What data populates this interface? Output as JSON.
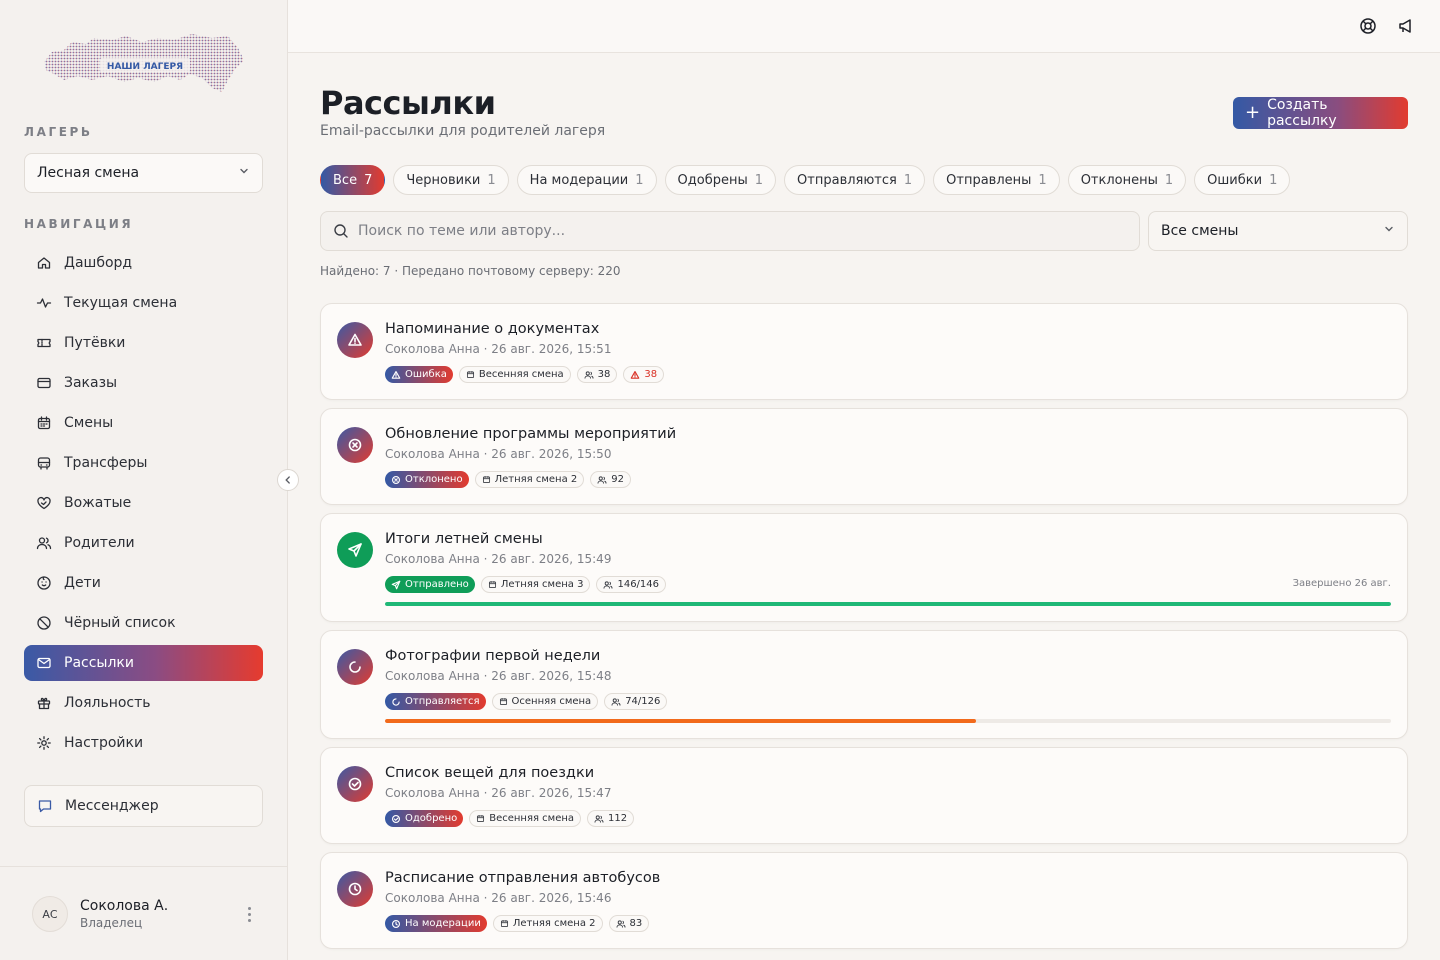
{
  "brand": {
    "logo_text": "НАШИ ЛАГЕРЯ"
  },
  "sidebar": {
    "camp_label": "ЛАГЕРЬ",
    "camp_value": "Лесная смена",
    "nav_label": "НАВИГАЦИЯ",
    "items": [
      {
        "label": "Дашборд",
        "icon": "home-icon"
      },
      {
        "label": "Текущая смена",
        "icon": "activity-icon"
      },
      {
        "label": "Путёвки",
        "icon": "ticket-icon"
      },
      {
        "label": "Заказы",
        "icon": "card-icon"
      },
      {
        "label": "Смены",
        "icon": "calendar-icon"
      },
      {
        "label": "Трансферы",
        "icon": "bus-icon"
      },
      {
        "label": "Вожатые",
        "icon": "heart-handshake-icon"
      },
      {
        "label": "Родители",
        "icon": "users-icon"
      },
      {
        "label": "Дети",
        "icon": "baby-icon"
      },
      {
        "label": "Чёрный список",
        "icon": "ban-icon"
      },
      {
        "label": "Рассылки",
        "icon": "mail-icon",
        "active": true
      },
      {
        "label": "Лояльность",
        "icon": "gift-icon"
      },
      {
        "label": "Настройки",
        "icon": "settings-icon"
      }
    ],
    "messenger": "Мессенджер",
    "user": {
      "initials": "АС",
      "name": "Соколова А.",
      "role": "Владелец"
    }
  },
  "header": {
    "title": "Рассылки",
    "subtitle": "Email-рассылки для родителей лагеря",
    "create_label": "Создать рассылку"
  },
  "filters": [
    {
      "label": "Все",
      "count": "7",
      "active": true
    },
    {
      "label": "Черновики",
      "count": "1"
    },
    {
      "label": "На модерации",
      "count": "1"
    },
    {
      "label": "Одобрены",
      "count": "1"
    },
    {
      "label": "Отправляются",
      "count": "1"
    },
    {
      "label": "Отправлены",
      "count": "1"
    },
    {
      "label": "Отклонены",
      "count": "1"
    },
    {
      "label": "Ошибки",
      "count": "1"
    }
  ],
  "search": {
    "placeholder": "Поиск по теме или автору..."
  },
  "shift_filter": {
    "value": "Все смены"
  },
  "found_text": "Найдено: 7 · Передано почтовому серверу: 220",
  "colors": {
    "accent_blue": "#3459a5",
    "accent_red": "#e23b2f",
    "green": "#0f9d58",
    "orange": "#f26a1b"
  },
  "mailings": [
    {
      "title": "Напоминание о документах",
      "meta": "Соколова Анна · 26 авг. 2026, 15:51",
      "status": "Ошибка",
      "status_icon": "alert-triangle-icon",
      "shift": "Весенняя смена",
      "recipients": "38",
      "errors": "38"
    },
    {
      "title": "Обновление программы мероприятий",
      "meta": "Соколова Анна · 26 авг. 2026, 15:50",
      "status": "Отклонено",
      "status_icon": "x-circle-icon",
      "shift": "Летняя смена 2",
      "recipients": "92"
    },
    {
      "title": "Итоги летней смены",
      "meta": "Соколова Анна · 26 авг. 2026, 15:49",
      "status": "Отправлено",
      "status_icon": "send-icon",
      "shift": "Летняя смена 3",
      "recipients": "146/146",
      "done": "Завершено 26 авг.",
      "progress": 1.0
    },
    {
      "title": "Фотографии первой недели",
      "meta": "Соколова Анна · 26 авг. 2026, 15:48",
      "status": "Отправляется",
      "status_icon": "loader-icon",
      "shift": "Осенняя смена",
      "recipients": "74/126",
      "progress": 0.587
    },
    {
      "title": "Список вещей для поездки",
      "meta": "Соколова Анна · 26 авг. 2026, 15:47",
      "status": "Одобрено",
      "status_icon": "check-circle-icon",
      "shift": "Весенняя смена",
      "recipients": "112"
    },
    {
      "title": "Расписание отправления автобусов",
      "meta": "Соколова Анна · 26 авг. 2026, 15:46",
      "status": "На модерации",
      "status_icon": "clock-icon",
      "shift": "Летняя смена 2",
      "recipients": "83"
    }
  ]
}
